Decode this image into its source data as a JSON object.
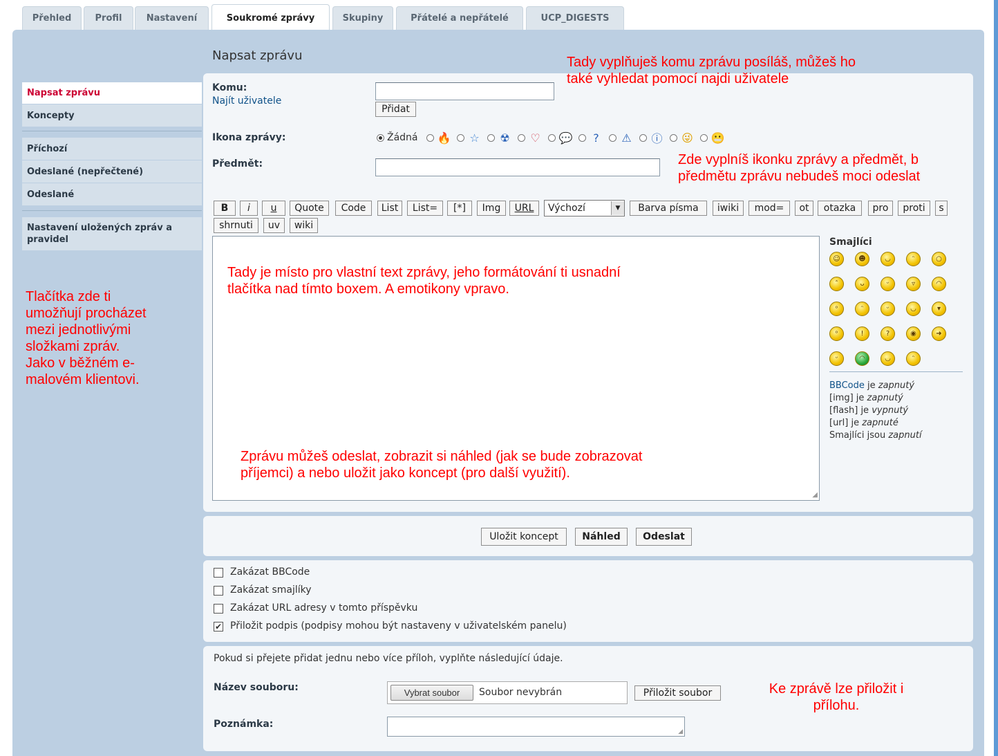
{
  "tabs": [
    {
      "label": "Přehled",
      "active": false
    },
    {
      "label": "Profil",
      "active": false
    },
    {
      "label": "Nastavení",
      "active": false
    },
    {
      "label": "Soukromé zprávy",
      "active": true
    },
    {
      "label": "Skupiny",
      "active": false
    },
    {
      "label": "Přátelé a nepřátelé",
      "active": false
    },
    {
      "label": "UCP_DIGESTS",
      "active": false
    }
  ],
  "sidebar": {
    "items": [
      {
        "label": "Napsat zprávu",
        "active": true
      },
      {
        "label": "Koncepty"
      },
      {
        "label": "Příchozí"
      },
      {
        "label": "Odeslané (nepřečtené)"
      },
      {
        "label": "Odeslané"
      },
      {
        "label": "Nastavení uložených zpráv a pravidel"
      }
    ]
  },
  "page_title": "Napsat zprávu",
  "form": {
    "to_label": "Komu:",
    "find_user": "Najít uživatele",
    "to_value": "",
    "add_button": "Přidat",
    "icon_label": "Ikona zprávy:",
    "icon_none": "Žádná",
    "icons": [
      "fire-icon",
      "star-icon",
      "radioactive-icon",
      "heart-icon",
      "speech-bubble-icon",
      "question-icon",
      "warning-icon",
      "info-icon",
      "wink-smiley-icon",
      "grin-smiley-icon"
    ],
    "subject_label": "Předmět:",
    "subject_value": ""
  },
  "toolbar": {
    "buttons": [
      "B",
      "i",
      "u",
      "Quote",
      "Code",
      "List",
      "List=",
      "[*]",
      "Img",
      "URL"
    ],
    "font_select": "Výchozí",
    "buttons2": [
      "Barva písma",
      "iwiki",
      "mod=",
      "ot",
      "otazka",
      "pro",
      "proti",
      "s"
    ],
    "buttons3": [
      "shrnuti",
      "uv",
      "wiki"
    ]
  },
  "smilies": {
    "title": "Smajlíci",
    "count": 24
  },
  "status_notes": {
    "bbcode_link": "BBCode",
    "bbcode_is": " je ",
    "bbcode_state": "zapnutý",
    "img_label": "[img] je ",
    "img_state": "zapnutý",
    "flash_label": "[flash] je ",
    "flash_state": "vypnutý",
    "url_label": "[url] je ",
    "url_state": "zapnuté",
    "smilies_label": "Smajlíci jsou ",
    "smilies_state": "zapnutí"
  },
  "actions": {
    "save_draft": "Uložit koncept",
    "preview": "Náhled",
    "send": "Odeslat"
  },
  "options": [
    {
      "label": "Zakázat BBCode",
      "checked": false
    },
    {
      "label": "Zakázat smajlíky",
      "checked": false
    },
    {
      "label": "Zakázat URL adresy v tomto příspěvku",
      "checked": false
    },
    {
      "label": "Přiložit podpis (podpisy mohou být nastaveny v uživatelském panelu)",
      "checked": true
    }
  ],
  "attachments": {
    "intro": "Pokud si přejete přidat jednu nebo více příloh, vyplňte následující údaje.",
    "filename_label": "Název souboru:",
    "choose_file": "Vybrat soubor",
    "no_file": "Soubor nevybrán",
    "attach_button": "Přiložit soubor",
    "comment_label": "Poznámka:",
    "comment_value": ""
  },
  "annotations": {
    "to": "Tady vyplňuješ komu zprávu posíláš, můžeš ho také vyhledat pomocí najdi uživatele",
    "to_line1": "Tady vyplňuješ komu zprávu posíláš, můžeš ho",
    "to_line2": "také vyhledat pomocí najdi uživatele",
    "icon_line1": "Zde vyplníš ikonku zprávy a předmět, b",
    "icon_line2": "předmětu zprávu nebudeš moci odeslat",
    "body_line1": "Tady je místo pro vlastní text zprávy, jeho formátování ti usnadní",
    "body_line2": "tlačítka nad tímto boxem. A emotikony vpravo.",
    "send_line1": "Zprávu můžeš odeslat, zobrazit si náhled (jak se bude zobrazovat",
    "send_line2": "příjemci) a nebo uložit jako koncept (pro další využití).",
    "sidebar_note": "Tlačítka zde ti umožňují procházet mezi jednotlivými složkami zpráv. Jako v běžném e-malovém klientovi.",
    "sidebar_lines": [
      "Tlačítka zde ti",
      "umožňují procházet",
      "mezi jednotlivými",
      "složkami zpráv.",
      "Jako v běžném e-",
      "malovém klientovi."
    ],
    "attach_line1": "Ke zprávě lze přiložit i",
    "attach_line2": "přílohu."
  },
  "colors": {
    "annotation": "#ff0000",
    "panel_bg": "#bccfe2",
    "active_sidebar": "#cc0033",
    "edge_bar": "#5e9ad6"
  }
}
